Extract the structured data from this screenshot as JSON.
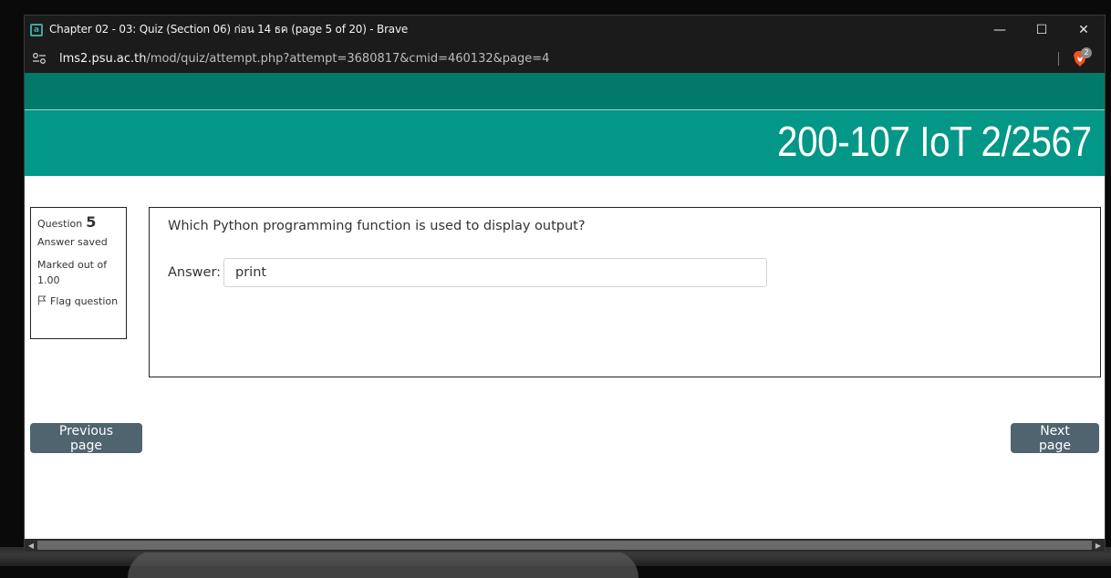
{
  "window": {
    "title": "Chapter 02 - 03: Quiz (Section 06) ก่อน 14 ธค (page 5 of 20) - Brave",
    "controls": {
      "minimize": "—",
      "maximize": "☐",
      "close": "✕"
    },
    "app_icon": "a"
  },
  "address": {
    "host": "lms2.psu.ac.th",
    "path": "/mod/quiz/attempt.php?attempt=3680817&cmid=460132&page=4",
    "shields_badge": "2"
  },
  "header": {
    "course_title": "200-107 IoT 2/2567"
  },
  "question_info": {
    "label": "Question",
    "number": "5",
    "state": "Answer saved",
    "grade": "Marked out of 1.00",
    "flag_label": "Flag question"
  },
  "question": {
    "text": "Which Python programming function is used to display output?",
    "answer_label": "Answer:",
    "answer_value": "print"
  },
  "navigation": {
    "previous_label": "Previous page",
    "next_label": "Next page"
  },
  "colors": {
    "header_dark": "#027a6a",
    "header": "#029786",
    "button": "#4f646f"
  }
}
